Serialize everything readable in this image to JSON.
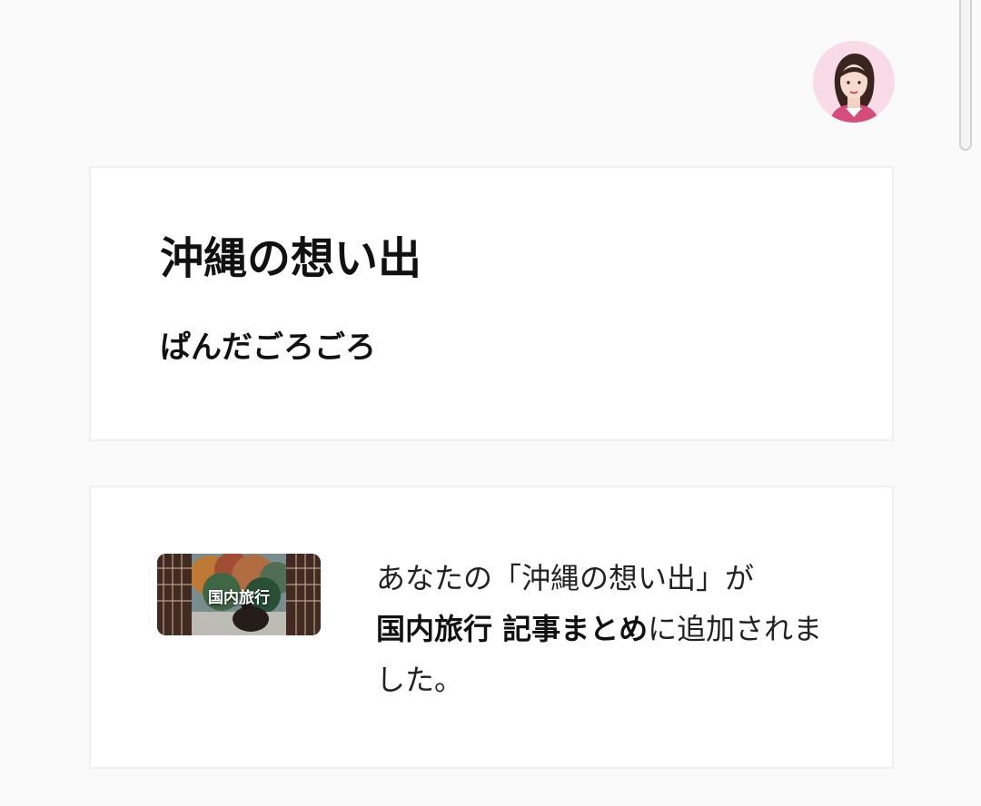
{
  "header": {
    "avatar_icon": "user-avatar-icon"
  },
  "article_card": {
    "title": "沖縄の想い出",
    "author": "ぱんだごろごろ"
  },
  "notification_card": {
    "thumbnail_label": "国内旅行",
    "message_prefix": "あなたの「沖縄の想い出」が",
    "magazine_name": "国内旅行 記事まとめ",
    "message_suffix": "に追加されました。"
  },
  "colors": {
    "background": "#fafafa",
    "card_background": "#ffffff",
    "card_border": "#efefef",
    "avatar_background": "#f8dbe6"
  }
}
